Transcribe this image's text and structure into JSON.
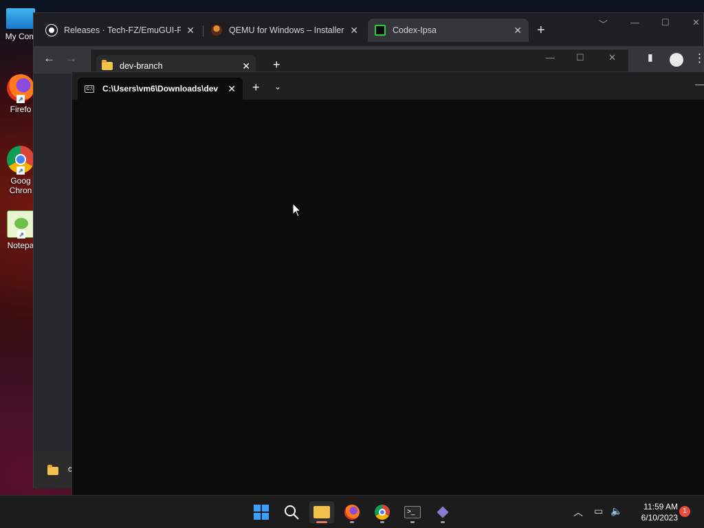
{
  "desktop": {
    "icons": [
      {
        "label": "My Com"
      },
      {
        "label": "Firefo"
      },
      {
        "label": "Goog Chron"
      },
      {
        "label": "Notepa"
      }
    ]
  },
  "chrome": {
    "tabs": [
      {
        "label": "Releases · Tech-FZ/EmuGUI-PreR",
        "icon": "github-icon"
      },
      {
        "label": "QEMU for Windows – Installers (",
        "icon": "qemu-icon"
      },
      {
        "label": "Codex-Ipsa",
        "icon": "codex-icon"
      }
    ],
    "new_tab": "+",
    "close_glyph": "✕"
  },
  "explorer": {
    "tab_label": "dev-branch",
    "new_tab": "+",
    "hidden_label": "c"
  },
  "terminal": {
    "tab_label": "C:\\Users\\vm6\\Downloads\\dev",
    "new_tab": "+",
    "cmd_glyph": "C:\\"
  },
  "taskbar": {
    "time": "11:59 AM",
    "date": "6/10/2023",
    "notification_count": "1",
    "items": [
      "start-icon",
      "search-icon",
      "file-explorer-icon",
      "firefox-icon",
      "chrome-icon",
      "terminal-icon",
      "visual-studio-icon"
    ]
  },
  "colors": {
    "accent": "#e0795a",
    "folder": "#f2c14e",
    "notification": "#e74c3c"
  }
}
